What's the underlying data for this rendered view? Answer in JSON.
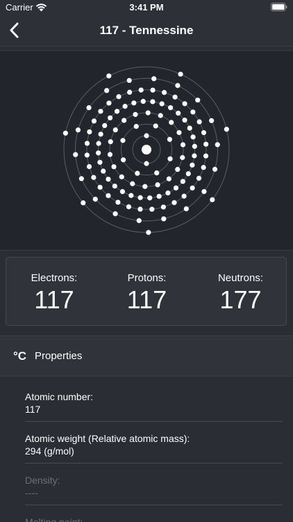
{
  "status_bar": {
    "carrier": "Carrier",
    "time": "3:41 PM",
    "wifi_icon": "wifi-icon",
    "battery_icon": "battery-full-icon"
  },
  "nav": {
    "title": "117 - Tennessine",
    "back_icon": "chevron-left-icon"
  },
  "atom": {
    "shell_electrons": [
      2,
      8,
      18,
      32,
      32,
      18,
      7
    ],
    "colors": {
      "nucleus": "#ffffff",
      "electron": "#ffffff",
      "orbit": "#5a5d63"
    }
  },
  "counts": {
    "electrons": {
      "label": "Electrons:",
      "value": "117"
    },
    "protons": {
      "label": "Protons:",
      "value": "117"
    },
    "neutrons": {
      "label": "Neutrons:",
      "value": "177"
    }
  },
  "properties": {
    "icon": "celsius-icon",
    "icon_glyph": "°C",
    "title": "Properties",
    "rows": [
      {
        "label": "Atomic number:",
        "value": "117"
      },
      {
        "label": "Atomic weight (Relative atomic mass):",
        "value": "294 (g/mol)"
      },
      {
        "label": "Density:",
        "value": "----"
      },
      {
        "label": "Melting point:",
        "value": ""
      }
    ]
  },
  "colors": {
    "background": "#2a2d33",
    "diagram_background": "#22252b",
    "card": "#30333a",
    "muted_text": "#6c6f76"
  }
}
